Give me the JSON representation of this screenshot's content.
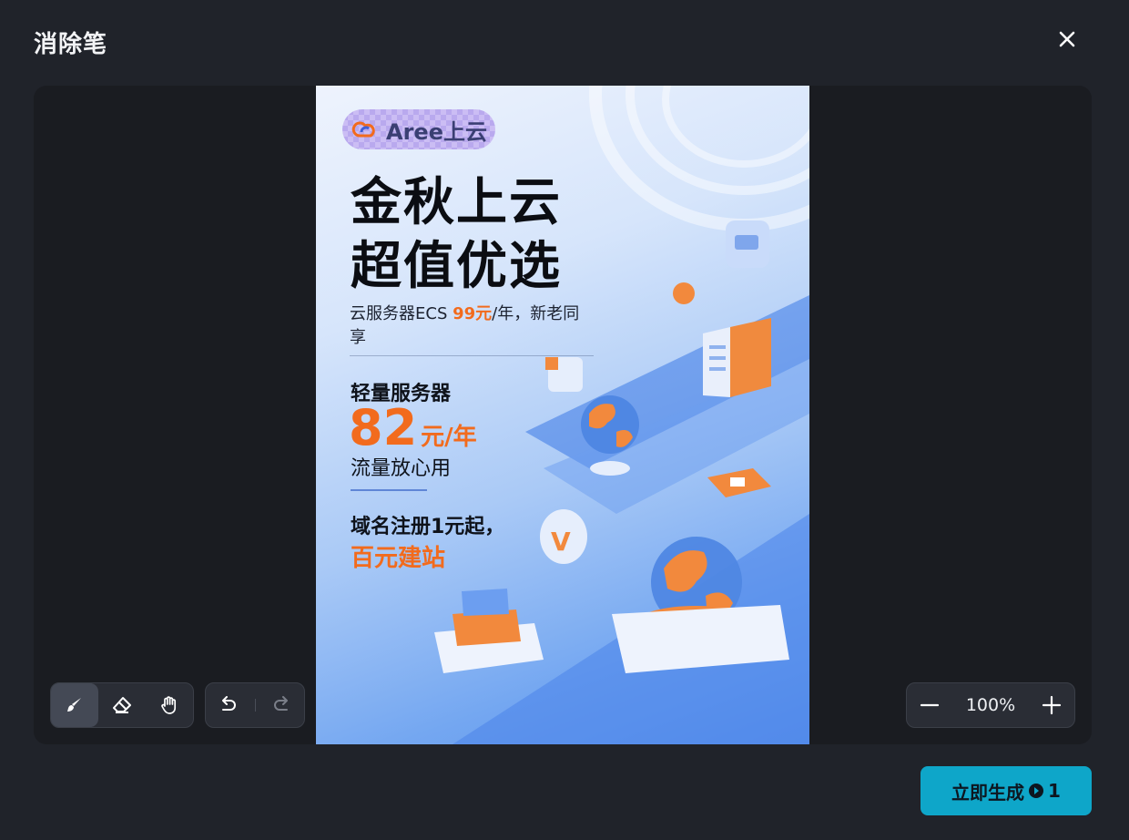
{
  "dialog": {
    "title": "消除笔"
  },
  "poster": {
    "logo_text": "Aree上云",
    "headline": [
      "金秋上云",
      "超值优选"
    ],
    "subline": {
      "prefix": "云服务器ECS ",
      "price": "99元",
      "suffix": "/年，新老同享"
    },
    "light_server": {
      "title": "轻量服务器",
      "price_number": "82",
      "price_unit": "元/年",
      "desc": "流量放心用"
    },
    "domain": {
      "line1": "域名注册1元起，",
      "line2": "百元建站"
    }
  },
  "toolbar": {
    "tools": [
      "brush-tool",
      "eraser-tool",
      "hand-tool"
    ],
    "active": "brush-tool"
  },
  "zoom": {
    "value": "100%"
  },
  "generate": {
    "label": "立即生成",
    "cost": "1"
  },
  "colors": {
    "accent": "#0ea6c9",
    "orange": "#f26b1d",
    "background": "#20232a",
    "panel": "#1a1c21"
  }
}
